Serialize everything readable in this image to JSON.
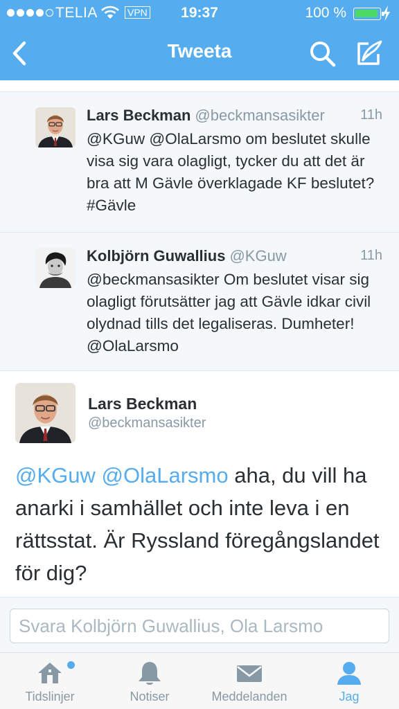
{
  "status_bar": {
    "carrier": "TELIA",
    "vpn": "VPN",
    "time": "19:37",
    "battery": "100 %",
    "signal_bars_filled": 4,
    "signal_bars_total": 5
  },
  "nav": {
    "title": "Tweeta",
    "icons": [
      "back-chevron-icon",
      "search-icon",
      "compose-icon"
    ]
  },
  "replies": [
    {
      "name": "Lars Beckman",
      "handle": "@beckmansasikter",
      "time": "11h",
      "text": "@KGuw @OlaLarsmo om beslutet skulle visa sig vara olagligt, tycker du att det är bra att M Gävle överklagade KF beslutet? #Gävle"
    },
    {
      "name": "Kolbjörn Guwallius",
      "handle": "@KGuw",
      "time": "11h",
      "text": "@beckmansasikter Om beslutet visar sig olagligt förutsätter jag att Gävle idkar civil olydnad tills det legaliseras. Dumheter! @OlaLarsmo"
    }
  ],
  "main_tweet": {
    "name": "Lars Beckman",
    "handle": "@beckmansasikter",
    "mention1": "@KGuw",
    "mention2": "@OlaLarsmo",
    "text": " aha, du vill ha anarki i samhället och inte leva i en rättsstat. Är Ryssland föregångslandet för dig?"
  },
  "reply_box": {
    "placeholder": "Svara Kolbjörn Guwallius, Ola Larsmo"
  },
  "tabs": [
    {
      "label": "Tidslinjer",
      "icon": "home-icon",
      "active": false
    },
    {
      "label": "Notiser",
      "icon": "bell-icon",
      "active": false
    },
    {
      "label": "Meddelanden",
      "icon": "envelope-icon",
      "active": false
    },
    {
      "label": "Jag",
      "icon": "person-icon",
      "active": true
    }
  ],
  "colors": {
    "brand": "#55acee",
    "text": "#292f33",
    "muted": "#8899a6",
    "reply_bg": "#f5f8fa",
    "battery": "#4cd964"
  }
}
